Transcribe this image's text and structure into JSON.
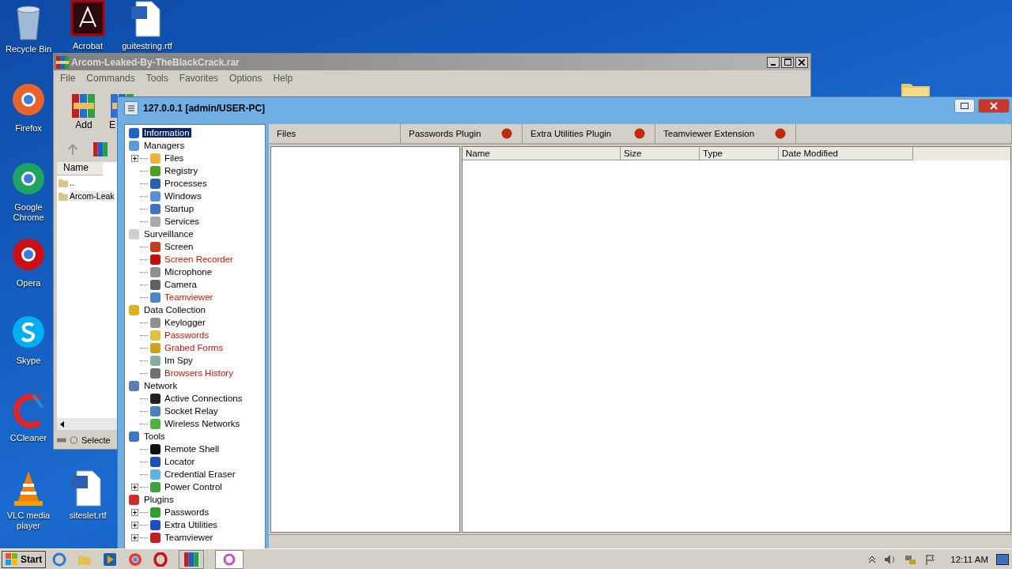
{
  "desktop_icons": [
    {
      "label": "Recycle Bin"
    },
    {
      "label": "Acrobat"
    },
    {
      "label": "guitestring.rtf"
    },
    {
      "label": "Firefox"
    },
    {
      "label": "Google Chrome"
    },
    {
      "label": "Opera"
    },
    {
      "label": "Skype"
    },
    {
      "label": "CCleaner"
    },
    {
      "label": "VLC media player"
    },
    {
      "label": "siteslet.rtf"
    }
  ],
  "archive_window": {
    "title": "Arcom-Leaked-By-TheBlackCrack.rar",
    "menu": [
      "File",
      "Commands",
      "Tools",
      "Favorites",
      "Options",
      "Help"
    ],
    "toolbar": [
      "Add",
      "E"
    ],
    "list_header": "Name",
    "rows": [
      "..",
      "Arcom-Leak"
    ],
    "status": "Selecte"
  },
  "main_window": {
    "title": "127.0.0.1 [admin/USER-PC]",
    "tree": [
      {
        "label": "Information",
        "selected": true,
        "highlighted": false
      },
      {
        "label": "Managers",
        "selected": false,
        "highlighted": false,
        "children": [
          {
            "label": "Files",
            "selected": false,
            "highlighted": false,
            "collapsed": true
          },
          {
            "label": "Registry",
            "selected": false,
            "highlighted": false,
            "collapsed": false
          },
          {
            "label": "Processes",
            "selected": false,
            "highlighted": false,
            "collapsed": false
          },
          {
            "label": "Windows",
            "selected": false,
            "highlighted": false,
            "collapsed": false
          },
          {
            "label": "Startup",
            "selected": false,
            "highlighted": false,
            "collapsed": false
          },
          {
            "label": "Services",
            "selected": false,
            "highlighted": false,
            "collapsed": false
          }
        ]
      },
      {
        "label": "Surveillance",
        "selected": false,
        "highlighted": false,
        "children": [
          {
            "label": "Screen",
            "selected": false,
            "highlighted": false,
            "collapsed": false
          },
          {
            "label": "Screen Recorder",
            "selected": false,
            "highlighted": true,
            "collapsed": false
          },
          {
            "label": "Microphone",
            "selected": false,
            "highlighted": false,
            "collapsed": false
          },
          {
            "label": "Camera",
            "selected": false,
            "highlighted": false,
            "collapsed": false
          },
          {
            "label": "Teamviewer",
            "selected": false,
            "highlighted": true,
            "collapsed": false
          }
        ]
      },
      {
        "label": "Data Collection",
        "selected": false,
        "highlighted": false,
        "children": [
          {
            "label": "Keylogger",
            "selected": false,
            "highlighted": false,
            "collapsed": false
          },
          {
            "label": "Passwords",
            "selected": false,
            "highlighted": true,
            "collapsed": false
          },
          {
            "label": "Grabed Forms",
            "selected": false,
            "highlighted": true,
            "collapsed": false
          },
          {
            "label": "Im Spy",
            "selected": false,
            "highlighted": false,
            "collapsed": false
          },
          {
            "label": "Browsers History",
            "selected": false,
            "highlighted": true,
            "collapsed": false
          }
        ]
      },
      {
        "label": "Network",
        "selected": false,
        "highlighted": false,
        "children": [
          {
            "label": "Active Connections",
            "selected": false,
            "highlighted": false,
            "collapsed": false
          },
          {
            "label": "Socket Relay",
            "selected": false,
            "highlighted": false,
            "collapsed": false
          },
          {
            "label": "Wireless Networks",
            "selected": false,
            "highlighted": false,
            "collapsed": false
          }
        ]
      },
      {
        "label": "Tools",
        "selected": false,
        "highlighted": false,
        "children": [
          {
            "label": "Remote Shell",
            "selected": false,
            "highlighted": false,
            "collapsed": false
          },
          {
            "label": "Locator",
            "selected": false,
            "highlighted": false,
            "collapsed": false
          },
          {
            "label": "Credential Eraser",
            "selected": false,
            "highlighted": false,
            "collapsed": false
          },
          {
            "label": "Power Control",
            "selected": false,
            "highlighted": false,
            "collapsed": true
          }
        ]
      },
      {
        "label": "Plugins",
        "selected": false,
        "highlighted": false,
        "children": [
          {
            "label": "Passwords",
            "selected": false,
            "highlighted": false,
            "collapsed": true
          },
          {
            "label": "Extra Utilities",
            "selected": false,
            "highlighted": false,
            "collapsed": true
          },
          {
            "label": "Teamviewer",
            "selected": false,
            "highlighted": false,
            "collapsed": true
          }
        ]
      }
    ],
    "tabs": [
      {
        "label": "Files",
        "status_dot": false
      },
      {
        "label": "Passwords Plugin",
        "status_dot": true
      },
      {
        "label": "Extra Utilities Plugin",
        "status_dot": true
      },
      {
        "label": "Teamviewer Extension",
        "status_dot": true
      }
    ],
    "columns": [
      "Name",
      "Size",
      "Type",
      "Date Modified"
    ]
  },
  "taskbar": {
    "start": "Start",
    "clock": "12:11 AM"
  }
}
